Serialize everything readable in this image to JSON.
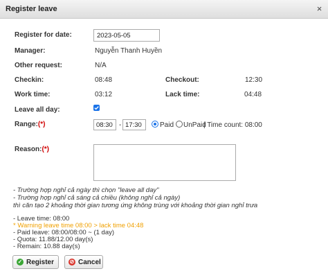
{
  "dialog": {
    "title": "Register leave",
    "close_glyph": "×"
  },
  "form": {
    "register_date": {
      "label": "Register for date:",
      "value": "2023-05-05"
    },
    "manager": {
      "label": "Manager:",
      "value": "Nguyễn Thanh Huyền"
    },
    "other_request": {
      "label": "Other request:",
      "value": "N/A"
    },
    "checkin": {
      "label": "Checkin:",
      "value": "08:48"
    },
    "checkout": {
      "label": "Checkout:",
      "value": "12:30"
    },
    "work_time": {
      "label": "Work time:",
      "value": "03:12"
    },
    "lack_time": {
      "label": "Lack time:",
      "value": "04:48"
    },
    "leave_all_day": {
      "label": "Leave all day:",
      "checked": true
    },
    "range": {
      "label": "Range:",
      "required_mark": "(*)",
      "from": "08:30",
      "dash": "-",
      "to": "17:30",
      "paid_label": "Paid",
      "unpaid_label": "UnPaid",
      "selected": "Paid",
      "time_count_text": "| Time count: 08:00"
    },
    "reason": {
      "label": "Reason:",
      "required_mark": "(*)",
      "value": ""
    }
  },
  "notes": [
    "- Trường hợp nghỉ cả ngày thì chọn \"leave all day\"",
    "- Trường hợp nghỉ cả sáng cả chiều (không nghỉ cả ngày)",
    "thì căn tạo 2 khoảng thời gian tương ứng không trùng với khoảng thời gian nghỉ trưa"
  ],
  "summary": {
    "leave_time": "- Leave time: 08:00",
    "warning": "* Warning leave time 08:00 > lack time 04:48",
    "paid_leave": "- Paid leave: 08:00/08:00 ~ (1 day)",
    "quota": "- Quota: 11.88/12.00 day(s)",
    "remain": "- Remain: 10.88 day(s)"
  },
  "buttons": {
    "register": "Register",
    "cancel": "Cancel"
  },
  "colors": {
    "accent": "#1a73e8",
    "required": "#d00000",
    "warning": "#f0a000",
    "register_icon": "#3aa635",
    "cancel_icon": "#d9342b"
  },
  "icons": {
    "close": "close-icon",
    "register": "check-circle-icon",
    "cancel": "cancel-circle-icon"
  }
}
